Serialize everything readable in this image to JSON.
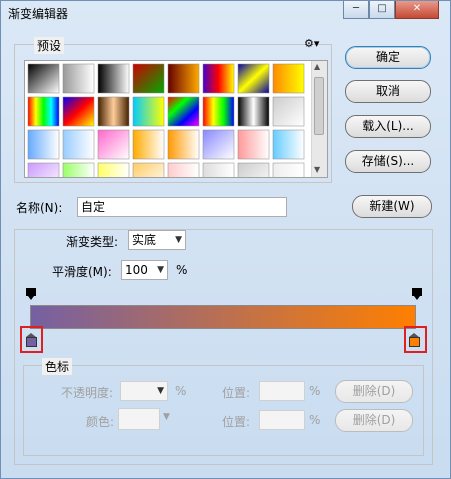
{
  "window": {
    "title": "渐变编辑器",
    "minimize": "─",
    "maximize": "□",
    "close": "✕"
  },
  "presets": {
    "label": "预设",
    "gear_icon": "gear-icon"
  },
  "buttons": {
    "ok": "确定",
    "cancel": "取消",
    "load": "载入(L)...",
    "save": "存储(S)...",
    "new": "新建(W)"
  },
  "name": {
    "label": "名称(N):",
    "value": "自定"
  },
  "gradient": {
    "type_label": "渐变类型:",
    "type_value": "实底",
    "smooth_label": "平滑度(M):",
    "smooth_value": "100",
    "smooth_unit": "%",
    "start_color": "#7560a3",
    "end_color": "#ff7f00"
  },
  "color_stops": {
    "label": "色标",
    "opacity_label": "不透明度:",
    "opacity_unit": "%",
    "location_label_1": "位置:",
    "location_unit_1": "%",
    "delete_label_1": "删除(D)",
    "color_label": "颜色:",
    "location_label_2": "位置:",
    "location_unit_2": "%",
    "delete_label_2": "删除(D)"
  }
}
